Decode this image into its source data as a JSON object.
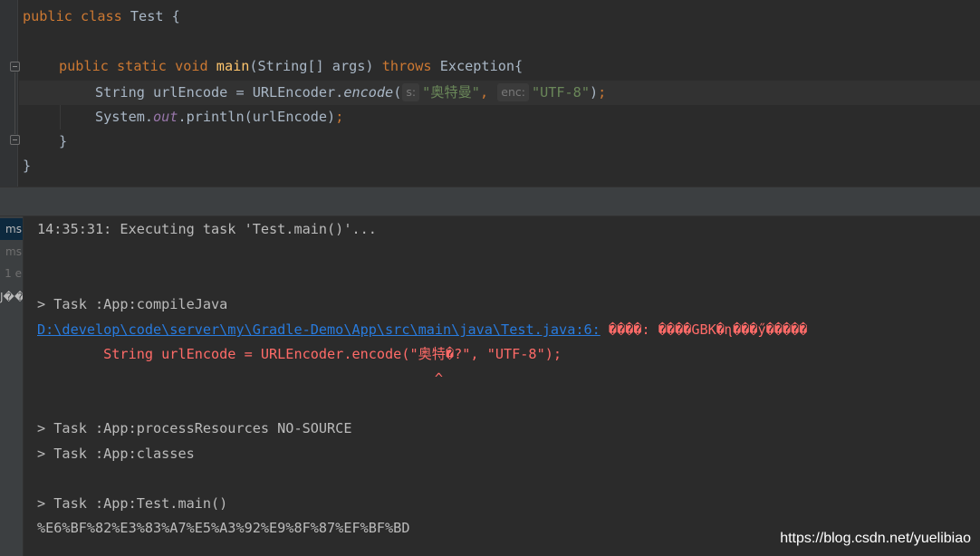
{
  "editor": {
    "class_decl": {
      "kw1": "public",
      "kw2": "class",
      "name": "Test",
      "brace": " {"
    },
    "main_decl": {
      "kw1": "public",
      "kw2": "static",
      "kw3": "void",
      "name": "main",
      "params": "(String[] args) ",
      "throws": "throws",
      "exception": " Exception{"
    },
    "encode_line": {
      "prefix": "String urlEncode = URLEncoder.",
      "method": "encode",
      "paren_open": "(",
      "hint1": "s:",
      "arg1": "\"奥特曼\"",
      "comma": ",",
      "hint2": "enc:",
      "arg2": "\"UTF-8\"",
      "paren_close": ")",
      "semi": ";"
    },
    "println_line": {
      "prefix": "System.",
      "field": "out",
      "rest": ".println(urlEncode)",
      "semi": ";"
    },
    "close_method": "}",
    "close_class": "}"
  },
  "console": {
    "side_items": [
      "ms",
      "ms",
      "1 e",
      "J��"
    ],
    "lines": {
      "executing": "14:35:31: Executing task 'Test.main()'...",
      "compile_task": "> Task :App:compileJava",
      "error_path": "D:\\develop\\code\\server\\my\\Gradle-Demo\\App\\src\\main\\java\\Test.java:6:",
      "error_msg": " ����: ����GBK�ɳ���ӳ�����",
      "error_source": "        String urlEncode = URLEncoder.encode(\"奥特�?\", \"UTF-8\");",
      "error_caret": "                                                ^",
      "process_resources": "> Task :App:processResources NO-SOURCE",
      "classes": "> Task :App:classes",
      "test_main": "> Task :App:Test.main()",
      "output": "%E6%BF%82%E3%83%A7%E5%A3%92%E9%8F%87%EF%BF%BD"
    }
  },
  "watermark": "https://blog.csdn.net/yuelibiao",
  "colors": {
    "background": "#2b2b2b",
    "keyword": "#cc7832",
    "method": "#ffc66d",
    "string": "#6a8759",
    "static_field": "#9876aa",
    "error": "#ff6b68",
    "link": "#287bde"
  }
}
